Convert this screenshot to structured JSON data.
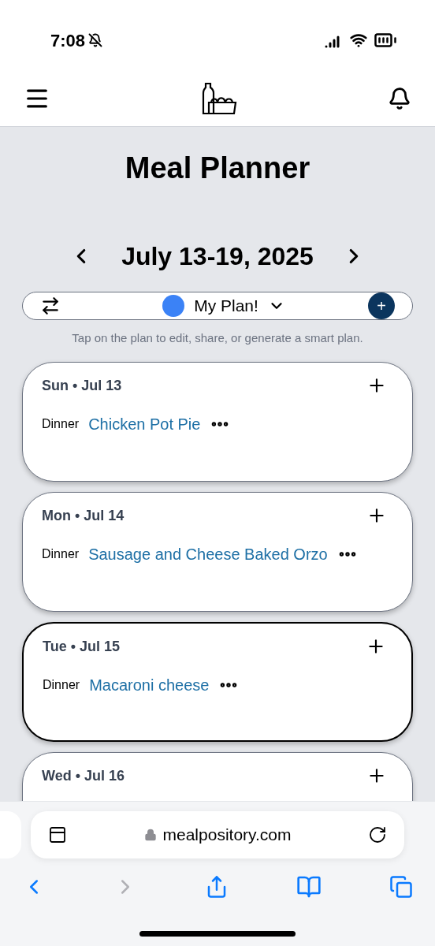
{
  "status_bar": {
    "time": "7:08",
    "silent": true
  },
  "title": "Meal Planner",
  "week": {
    "label": "July 13-19, 2025"
  },
  "plan": {
    "name": "My Plan!",
    "color": "#3b82f6",
    "add_label": "+"
  },
  "hint": "Tap on the plan to edit, share, or generate a smart plan.",
  "days": [
    {
      "label": "Sun • Jul 13",
      "selected": false,
      "meals": [
        {
          "type": "Dinner",
          "name": "Chicken Pot Pie"
        }
      ]
    },
    {
      "label": "Mon • Jul 14",
      "selected": false,
      "meals": [
        {
          "type": "Dinner",
          "name": "Sausage and Cheese Baked Orzo"
        }
      ]
    },
    {
      "label": "Tue • Jul 15",
      "selected": true,
      "meals": [
        {
          "type": "Dinner",
          "name": "Macaroni cheese"
        }
      ]
    },
    {
      "label": "Wed • Jul 16",
      "selected": false
    }
  ],
  "browser": {
    "url": "mealpository.com",
    "forward_disabled": true
  }
}
